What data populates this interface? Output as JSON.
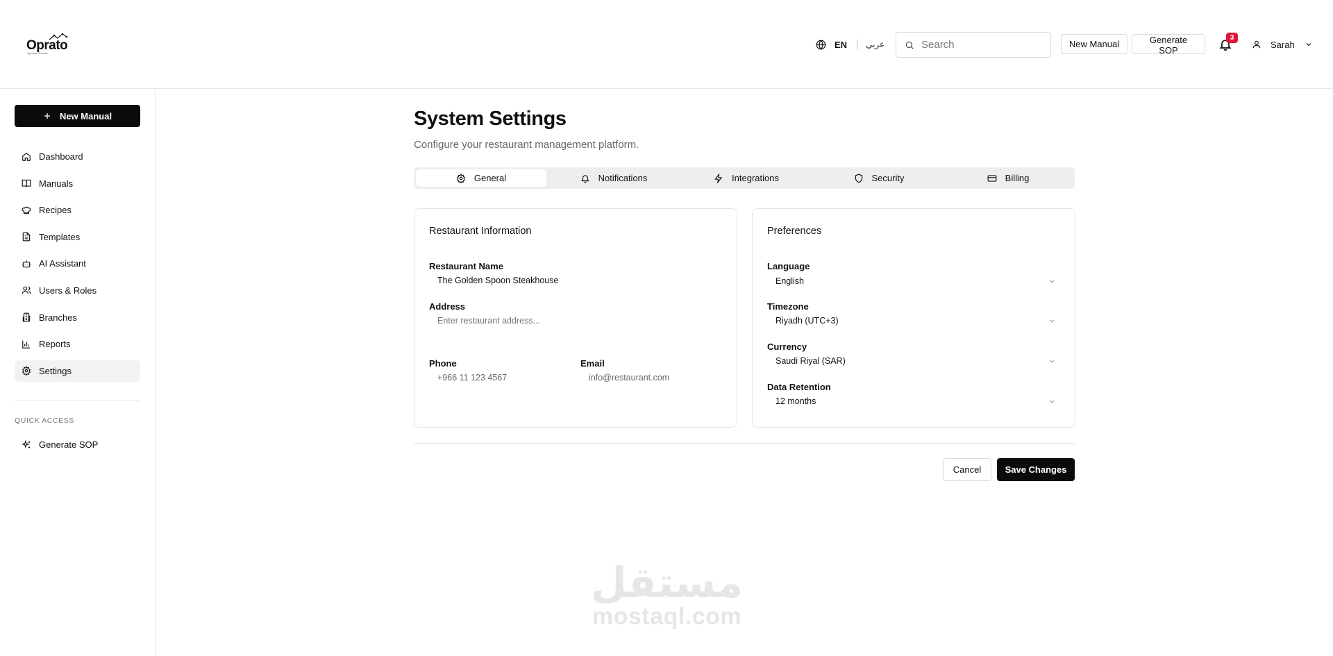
{
  "header": {
    "logo": {
      "name": "Oprato",
      "tagline": "Operation Manuals"
    },
    "language": {
      "current": "EN",
      "alternate": "عربي"
    },
    "search": {
      "placeholder": "Search"
    },
    "new_manual_label": "New Manual",
    "generate_sop_label": "Generate SOP",
    "notifications": {
      "count": "3"
    },
    "user": {
      "name": "Sarah"
    }
  },
  "sidebar": {
    "new_manual_label": "New Manual",
    "items": [
      {
        "label": "Dashboard",
        "icon": "home-icon"
      },
      {
        "label": "Manuals",
        "icon": "book-icon"
      },
      {
        "label": "Recipes",
        "icon": "chef-hat-icon"
      },
      {
        "label": "Templates",
        "icon": "file-text-icon"
      },
      {
        "label": "AI Assistant",
        "icon": "bot-icon"
      },
      {
        "label": "Users & Roles",
        "icon": "users-icon"
      },
      {
        "label": "Branches",
        "icon": "building-icon"
      },
      {
        "label": "Reports",
        "icon": "bar-chart-icon"
      },
      {
        "label": "Settings",
        "icon": "gear-icon",
        "active": true
      }
    ],
    "quick_access": {
      "label": "QUICK ACCESS",
      "items": [
        {
          "label": "Generate SOP",
          "icon": "sparkles-icon"
        }
      ]
    }
  },
  "page": {
    "title": "System Settings",
    "subtitle": "Configure your restaurant management platform."
  },
  "tabs": [
    {
      "label": "General",
      "icon": "gear-icon",
      "active": true
    },
    {
      "label": "Notifications",
      "icon": "bell-icon"
    },
    {
      "label": "Integrations",
      "icon": "zap-icon"
    },
    {
      "label": "Security",
      "icon": "shield-icon"
    },
    {
      "label": "Billing",
      "icon": "credit-card-icon"
    }
  ],
  "restaurant_info": {
    "title": "Restaurant Information",
    "name": {
      "label": "Restaurant Name",
      "value": "The Golden Spoon Steakhouse"
    },
    "address": {
      "label": "Address",
      "value": "",
      "placeholder": "Enter restaurant address..."
    },
    "phone": {
      "label": "Phone",
      "value": "+966 11 123 4567"
    },
    "email": {
      "label": "Email",
      "value": "info@restaurant.com"
    }
  },
  "preferences": {
    "title": "Preferences",
    "language": {
      "label": "Language",
      "value": "English"
    },
    "timezone": {
      "label": "Timezone",
      "value": "Riyadh (UTC+3)"
    },
    "currency": {
      "label": "Currency",
      "value": "Saudi Riyal (SAR)"
    },
    "data_retention": {
      "label": "Data Retention",
      "value": "12 months"
    }
  },
  "actions": {
    "cancel": "Cancel",
    "save": "Save Changes"
  },
  "watermark": {
    "arabic": "مستقل",
    "latin": "mostaql.com"
  }
}
